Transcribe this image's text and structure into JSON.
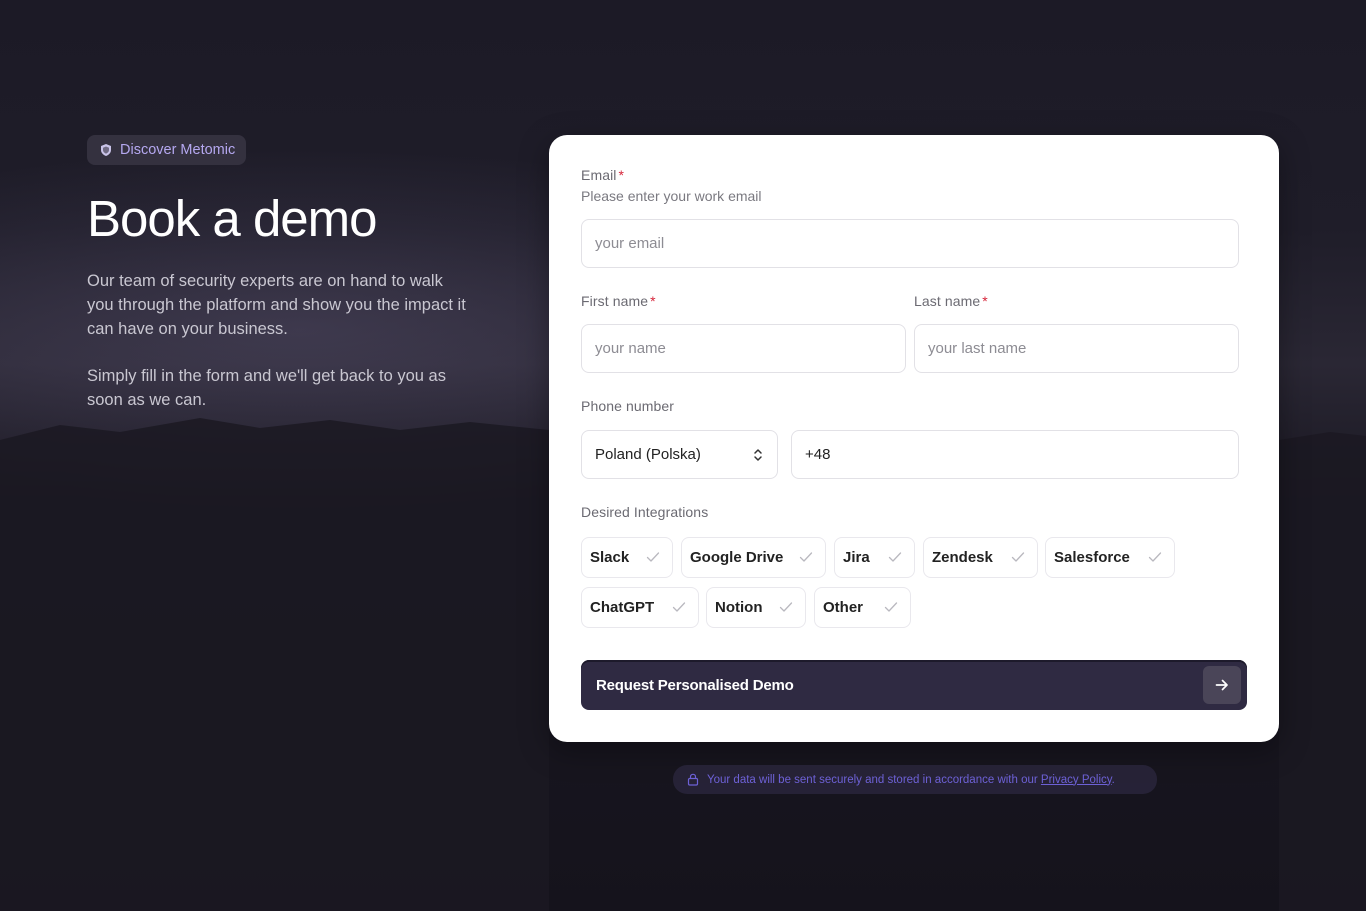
{
  "left": {
    "badge": {
      "icon": "shield-icon",
      "label": "Discover Metomic"
    },
    "title": "Book a demo",
    "paragraph1": "Our team of security experts are on hand to walk you through the platform and show you the impact it can have on your business.",
    "paragraph2": "Simply fill in the form and we'll get back to you as soon as we can."
  },
  "form": {
    "email": {
      "label": "Email",
      "required": "*",
      "hint": "Please enter your work email",
      "placeholder": "your email"
    },
    "first_name": {
      "label": "First name",
      "required": "*",
      "placeholder": "your name"
    },
    "last_name": {
      "label": "Last name",
      "required": "*",
      "placeholder": "your last name"
    },
    "phone": {
      "label": "Phone number",
      "country": "Poland (Polska)",
      "dial_code": "+48"
    },
    "integrations": {
      "label": "Desired Integrations",
      "options": [
        "Slack",
        "Google Drive",
        "Jira",
        "Zendesk",
        "Salesforce",
        "ChatGPT",
        "Notion",
        "Other"
      ]
    },
    "submit_label": "Request Personalised Demo"
  },
  "privacy": {
    "text": "Your data will be sent securely and stored in accordance with our",
    "link": "Privacy Policy",
    "suffix": "."
  },
  "colors": {
    "accent": "#b5a8f0",
    "button": "#2f2a42",
    "required": "#d6253a",
    "link": "#6d61d6"
  }
}
